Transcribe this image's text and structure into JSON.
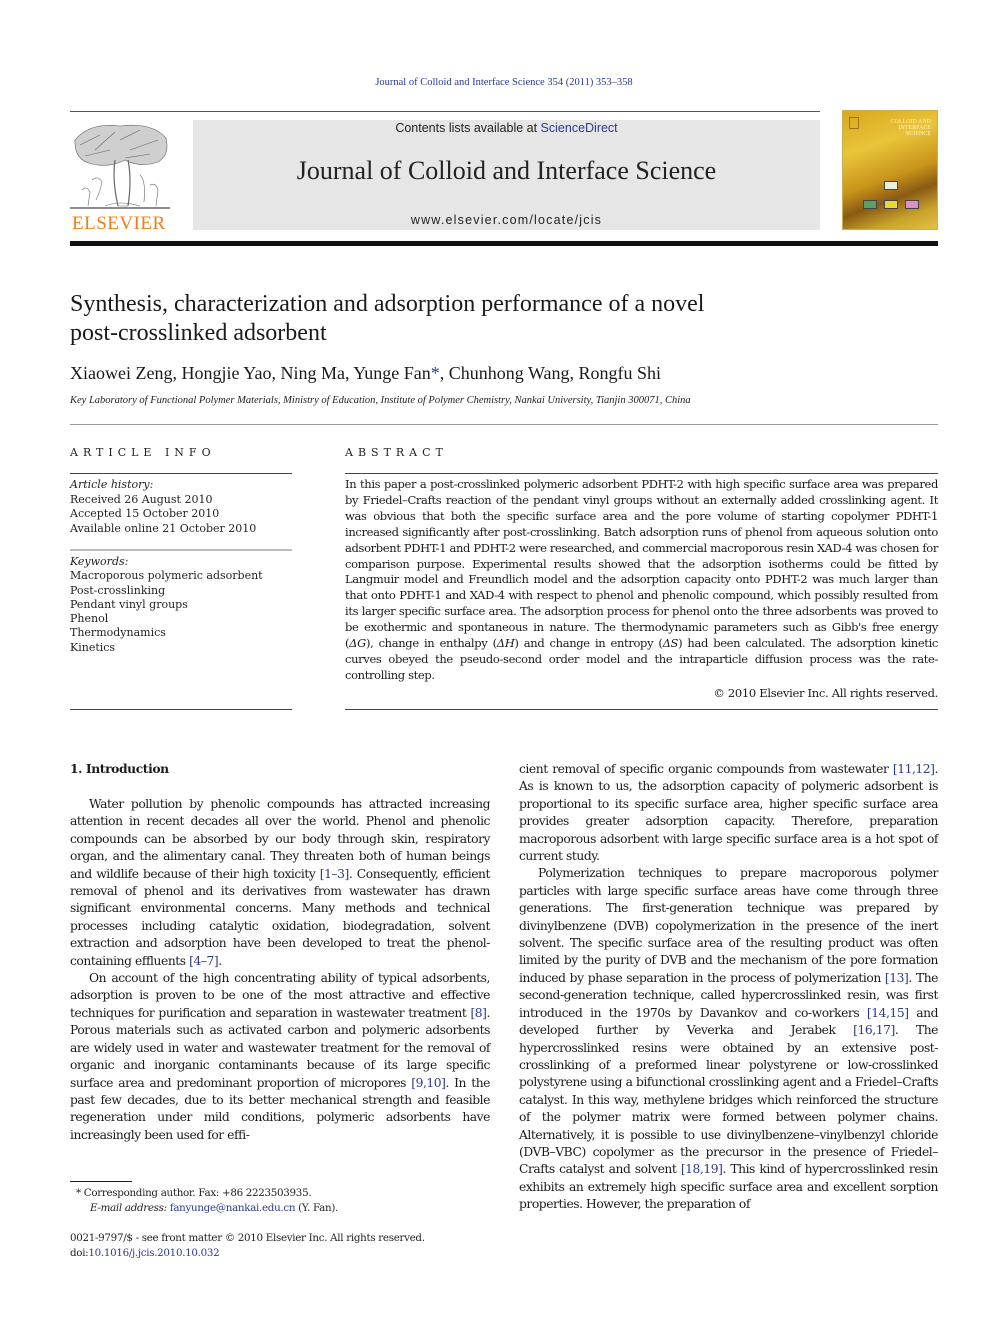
{
  "header": {
    "running_head": "Journal of Colloid and Interface Science 354 (2011) 353–358",
    "contents_prefix": "Contents lists available at ",
    "contents_link": "ScienceDirect",
    "journal_title": "Journal of Colloid and Interface Science",
    "journal_url": "www.elsevier.com/locate/jcis",
    "publisher_wordmark": "ELSEVIER",
    "publisher_color": "#f07f16",
    "link_color": "#2b3a8c",
    "cover": {
      "title_lines": [
        "COLLOID AND",
        "INTERFACE",
        "SCIENCE"
      ],
      "box_colors": [
        "#5aa060",
        "#e8d830",
        "#e090c0"
      ]
    }
  },
  "article": {
    "title_line1": "Synthesis, characterization and adsorption performance of a novel",
    "title_line2": "post-crosslinked adsorbent",
    "authors_before_star": "Xiaowei Zeng, Hongjie Yao, Ning Ma, Yunge Fan",
    "corresponding_mark": "*",
    "authors_after_star": ", Chunhong Wang, Rongfu Shi",
    "affiliation": "Key Laboratory of Functional Polymer Materials, Ministry of Education, Institute of Polymer Chemistry, Nankai University, Tianjin 300071, China"
  },
  "article_info": {
    "heading": "ARTICLE INFO",
    "history_label": "Article history:",
    "history": [
      "Received 26 August 2010",
      "Accepted 15 October 2010",
      "Available online 21 October 2010"
    ],
    "keywords_label": "Keywords:",
    "keywords": [
      "Macroporous polymeric adsorbent",
      "Post-crosslinking",
      "Pendant vinyl groups",
      "Phenol",
      "Thermodynamics",
      "Kinetics"
    ]
  },
  "abstract": {
    "heading": "ABSTRACT",
    "part1": "In this paper a post-crosslinked polymeric adsorbent PDHT-2 with high specific surface area was prepared by Friedel–Crafts reaction of the pendant vinyl groups without an externally added crosslinking agent. It was obvious that both the specific surface area and the pore volume of starting copolymer PDHT-1 increased significantly after post-crosslinking. Batch adsorption runs of phenol from aqueous solution onto adsorbent PDHT-1 and PDHT-2 were researched, and commercial macroporous resin XAD-4 was chosen for comparison purpose. Experimental results showed that the adsorption isotherms could be fitted by Langmuir model and Freundlich model and the adsorption capacity onto PDHT-2 was much larger than that onto PDHT-1 and XAD-4 with respect to phenol and phenolic compound, which possibly resulted from its larger specific surface area. The adsorption process for phenol onto the three adsorbents was proved to be exothermic and spontaneous in nature. The thermodynamic parameters such as Gibb's free energy (",
    "sym_g": "ΔG",
    "part2": "), change in enthalpy (",
    "sym_h": "ΔH",
    "part3": ") and change in entropy (",
    "sym_s": "ΔS",
    "part4": ") had been calculated. The adsorption kinetic curves obeyed the pseudo-second order model and the intraparticle diffusion process was the rate-controlling step.",
    "copyright": "© 2010 Elsevier Inc. All rights reserved."
  },
  "body": {
    "section_heading": "1. Introduction",
    "left": {
      "p1_a": "Water pollution by phenolic compounds has attracted increasing attention in recent decades all over the world. Phenol and phenolic compounds can be absorbed by our body through skin, respiratory organ, and the alimentary canal. They threaten both of human beings and wildlife because of their high toxicity ",
      "p1_ref1": "[1–3]",
      "p1_b": ". Consequently, efficient removal of phenol and its derivatives from wastewater has drawn significant environmental concerns. Many methods and technical processes including catalytic oxidation, biodegradation, solvent extraction and adsorption have been developed to treat the phenol-containing effluents ",
      "p1_ref2": "[4–7]",
      "p1_c": ".",
      "p2_a": "On account of the high concentrating ability of typical adsorbents, adsorption is proven to be one of the most attractive and effective techniques for purification and separation in wastewater treatment ",
      "p2_ref1": "[8]",
      "p2_b": ". Porous materials such as activated carbon and polymeric adsorbents are widely used in water and wastewater treatment for the removal of organic and inorganic contaminants because of its large specific surface area and predominant proportion of micropores ",
      "p2_ref2": "[9,10]",
      "p2_c": ". In the past few decades, due to its better mechanical strength and feasible regeneration under mild conditions, polymeric adsorbents have increasingly been used for effi-"
    },
    "right": {
      "p1_a": "cient removal of specific organic compounds from wastewater ",
      "p1_ref1": "[11,12]",
      "p1_b": ". As is known to us, the adsorption capacity of polymeric adsorbent is proportional to its specific surface area, higher specific surface area provides greater adsorption capacity. Therefore, preparation macroporous adsorbent with large specific surface area is a hot spot of current study.",
      "p2_a": "Polymerization techniques to prepare macroporous polymer particles with large specific surface areas have come through three generations. The first-generation technique was prepared by divinylbenzene (DVB) copolymerization in the presence of the inert solvent. The specific surface area of the resulting product was often limited by the purity of DVB and the mechanism of the pore formation induced by phase separation in the process of polymerization ",
      "p2_ref1": "[13]",
      "p2_b": ". The second-generation technique, called hypercrosslinked resin, was first introduced in the 1970s by Davankov and co-workers ",
      "p2_ref2": "[14,15]",
      "p2_c": " and developed further by Veverka and Jerabek ",
      "p2_ref3": "[16,17]",
      "p2_d": ". The hypercrosslinked resins were obtained by an extensive post-crosslinking of a preformed linear polystyrene or low-crosslinked polystyrene using a bifunctional crosslinking agent and a Friedel–Crafts catalyst. In this way, methylene bridges which reinforced the structure of the polymer matrix were formed between polymer chains. Alternatively, it is possible to use divinylbenzene–vinylbenzyl chloride (DVB–VBC) copolymer as the precursor in the presence of Friedel–Crafts catalyst and solvent ",
      "p2_ref4": "[18,19]",
      "p2_e": ". This kind of hypercrosslinked resin exhibits an extremely high specific surface area and excellent sorption properties. However, the preparation of"
    }
  },
  "footnotes": {
    "star": "*",
    "corresponding": " Corresponding author. Fax: +86 2223503935.",
    "email_label": "E-mail address:",
    "email": "fanyunge@nankai.edu.cn",
    "email_suffix": " (Y. Fan).",
    "frontmatter": "0021-9797/$ - see front matter © 2010 Elsevier Inc. All rights reserved.",
    "doi_prefix": "doi:",
    "doi": "10.1016/j.jcis.2010.10.032"
  }
}
